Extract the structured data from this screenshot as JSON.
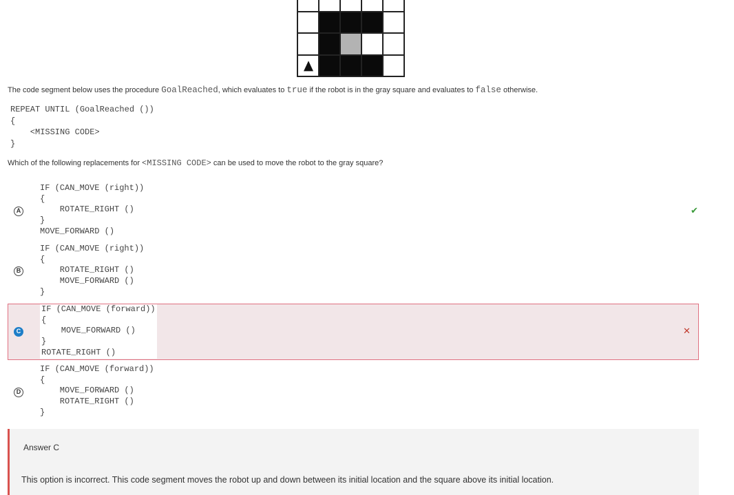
{
  "intro": {
    "text_before": "The code segment below uses the procedure ",
    "proc": "GoalReached",
    "text_mid": ", which evaluates to ",
    "true_word": "true",
    "text_mid2": " if the robot is in the gray square and evaluates to ",
    "false_word": "false",
    "text_after": " otherwise."
  },
  "main_code": "REPEAT UNTIL (GoalReached ())\n{\n    <MISSING CODE>\n}",
  "question": {
    "before": "Which of the following replacements for ",
    "code": "<MISSING CODE>",
    "after": " can be used to move the robot to the gray square?"
  },
  "options": [
    {
      "letter": "A",
      "code": "IF (CAN_MOVE (right))\n{\n    ROTATE_RIGHT ()\n}\nMOVE_FORWARD ()",
      "mark": "✔"
    },
    {
      "letter": "B",
      "code": "IF (CAN_MOVE (right))\n{\n    ROTATE_RIGHT ()\n    MOVE_FORWARD ()\n}"
    },
    {
      "letter": "C",
      "code": "IF (CAN_MOVE (forward))\n{\n    MOVE_FORWARD ()\n}\nROTATE_RIGHT ()",
      "mark": "✕"
    },
    {
      "letter": "D",
      "code": "IF (CAN_MOVE (forward))\n{\n    MOVE_FORWARD ()\n    ROTATE_RIGHT ()\n}"
    }
  ],
  "feedback": {
    "title": "Answer C",
    "body": "This option is incorrect. This code segment moves the robot up and down between its initial location and the square above its initial location."
  },
  "icons": {
    "correct": "check-icon",
    "incorrect": "close-icon",
    "robot": "triangle-up-icon"
  },
  "colors": {
    "correct": "#3a9a3a",
    "incorrect": "#c0392b",
    "selected_bg": "#f2e6e8",
    "selected_border": "#e07080",
    "radio_filled": "#1e7ec8"
  }
}
